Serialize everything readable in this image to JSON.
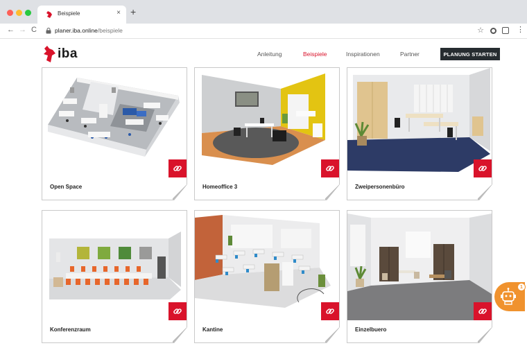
{
  "browser": {
    "tab_title": "Beispiele",
    "tab_close": "×",
    "new_tab": "+",
    "url_host": "planer.iba.online",
    "url_path": "/beispiele"
  },
  "header": {
    "logo_text": "iba",
    "nav": [
      "Anleitung",
      "Beispiele",
      "Inspirationen",
      "Partner"
    ],
    "cta_label": "PLANUNG STARTEN"
  },
  "cards": [
    {
      "title": "Open Space"
    },
    {
      "title": "Homeoffice 3"
    },
    {
      "title": "Zweipersonenbüro"
    },
    {
      "title": "Konferenzraum"
    },
    {
      "title": "Kantine"
    },
    {
      "title": "Einzelbuero"
    }
  ],
  "chat": {
    "badge_count": "1"
  },
  "colors": {
    "brand_red": "#d9132b",
    "dark_button": "#262c30",
    "chat_orange": "#f0922e"
  },
  "icons": [
    "iba-logo-icon",
    "link-icon",
    "chat-robot-icon",
    "lock-icon",
    "star-icon"
  ]
}
